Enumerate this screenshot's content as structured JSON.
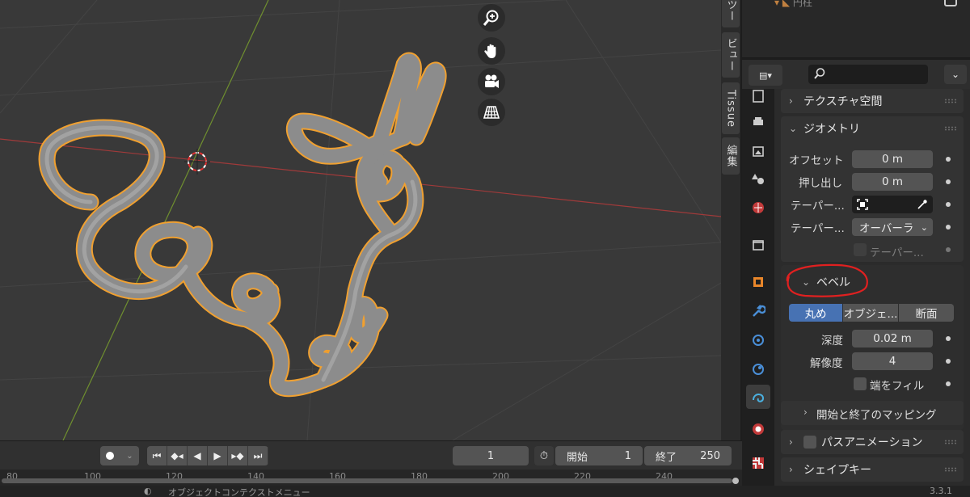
{
  "colors": {
    "accent": "#4772b3",
    "selection_outline": "#f0a030",
    "annotation": "#e02020",
    "x_axis": "#a03a3a",
    "y_axis": "#6f8f2f"
  },
  "vertical_tabs": [
    "ツー",
    "ビュー",
    "Tissue",
    "編集"
  ],
  "outliner": {
    "partial_item": "円柱"
  },
  "properties_header": {
    "editor_icon": "properties-editor-icon",
    "search": {
      "value": "",
      "placeholder": ""
    },
    "dropdown": "⌄"
  },
  "panels": {
    "texture_space": {
      "title": "テクスチャ空間",
      "expanded": false
    },
    "geometry": {
      "title": "ジオメトリ",
      "expanded": true,
      "offset": {
        "label": "オフセット",
        "value": "0 m"
      },
      "extrude": {
        "label": "押し出し",
        "value": "0 m"
      },
      "taper_object": {
        "label": "テーパー..."
      },
      "taper_mode": {
        "label": "テーパー...",
        "value": "オーバーラ"
      },
      "taper_check": {
        "label": "テーパー..."
      }
    },
    "bevel": {
      "title": "ベベル",
      "expanded": true,
      "modes": [
        "丸め",
        "オブジェ...",
        "断面"
      ],
      "active_mode": 0,
      "depth": {
        "label": "深度",
        "value": "0.02 m"
      },
      "resolution": {
        "label": "解像度",
        "value": "4"
      },
      "fill_caps": {
        "label": "端をフィル"
      },
      "mapping": {
        "title": "開始と終了のマッピング"
      }
    },
    "path_animation": {
      "title": "パスアニメーション"
    },
    "shape_keys": {
      "title": "シェイプキー"
    }
  },
  "timeline": {
    "current_frame": "1",
    "start_label": "開始",
    "start_value": "1",
    "end_label": "終了",
    "end_value": "250",
    "ruler_ticks": [
      "80",
      "100",
      "120",
      "140",
      "160",
      "180",
      "200",
      "220",
      "240"
    ]
  },
  "statusbar": {
    "text": "オブジェクトコンテクストメニュー",
    "version": "3.3.1"
  }
}
